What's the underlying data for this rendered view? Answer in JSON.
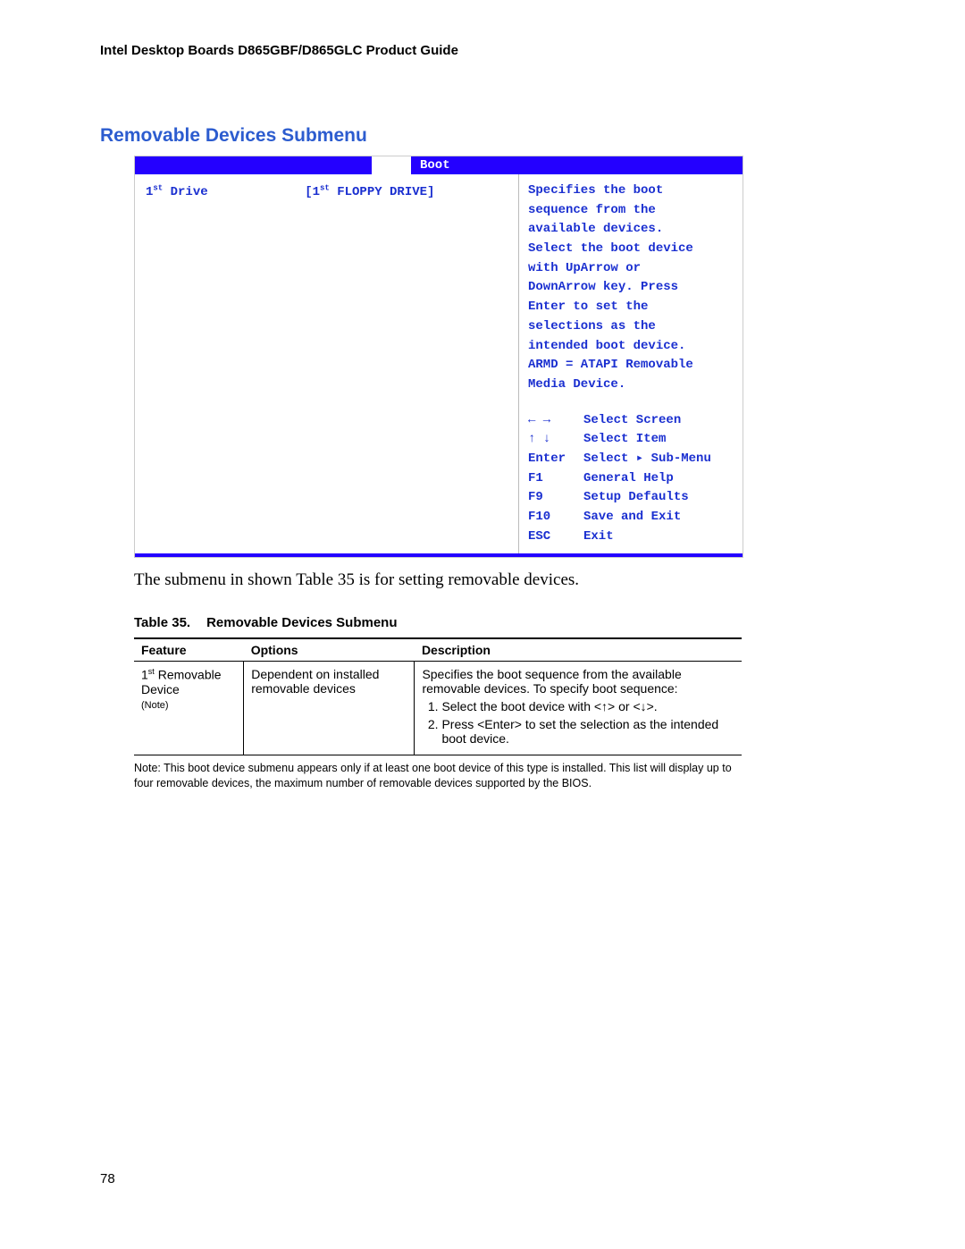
{
  "doc": {
    "header": "Intel Desktop Boards D865GBF/D865GLC Product Guide",
    "page": "78"
  },
  "section": {
    "title": "Removable Devices Submenu"
  },
  "bios": {
    "tab": "Boot",
    "row1_label_pre": "1",
    "row1_label_sup": "st",
    "row1_label_post": " Drive",
    "row1_val_pre": "[1",
    "row1_val_sup": "st",
    "row1_val_post": " FLOPPY DRIVE]",
    "help1": "Specifies the boot",
    "help2": "sequence from the",
    "help3": "available devices.",
    "help4": "Select the boot device",
    "help5": "with UpArrow or",
    "help6": "DownArrow key.  Press",
    "help7": "Enter to set the",
    "help8": "selections as the",
    "help9": "intended boot device.",
    "help10": "ARMD = ATAPI Removable",
    "help11": "Media Device.",
    "nav": {
      "k1": "← →",
      "v1": "Select Screen",
      "k2": "↑ ↓",
      "v2": "Select Item",
      "k3": "Enter",
      "v3": "Select ▸ Sub-Menu",
      "k4": "F1",
      "v4": "General Help",
      "k5": "F9",
      "v5": "Setup Defaults",
      "k6": "F10",
      "v6": "Save and Exit",
      "k7": "ESC",
      "v7": "Exit"
    }
  },
  "after": "The submenu in shown Table 35 is for setting removable devices.",
  "table": {
    "caption_a": "Table 35.",
    "caption_b": "Removable Devices Submenu",
    "h1": "Feature",
    "h2": "Options",
    "h3": "Description",
    "feature_pre": "1",
    "feature_sup": "st",
    "feature_post": " Removable Device",
    "feature_note": "(Note)",
    "options": "Dependent on installed removable devices",
    "desc_lead": "Specifies the boot sequence from the available removable devices.  To specify boot sequence:",
    "step1": "Select the boot device with <↑> or <↓>.",
    "step2": "Press <Enter> to set the selection as the intended boot device."
  },
  "footnote": "Note: This boot device submenu appears only if at least one boot device of this type is installed.  This list will display up to four removable devices, the maximum number of removable devices supported by the BIOS."
}
